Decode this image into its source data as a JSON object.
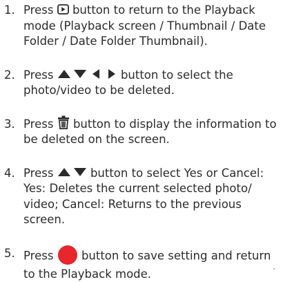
{
  "steps": [
    {
      "number": "1.",
      "before": "Press",
      "icon": "playback-icon",
      "after": "button to return to the Playback mode (Playback screen / Thumbnail / Date Folder / Date Folder Thumbnail)."
    },
    {
      "number": "2.",
      "before": "Press",
      "icon": "arrow-buttons-icon",
      "after": "button to select the photo/video to be deleted."
    },
    {
      "number": "3.",
      "before": "Press",
      "icon": "trash-icon",
      "after": "button to display the information to be deleted on the screen."
    },
    {
      "number": "4.",
      "before": "Press",
      "icon": "up-down-arrows-icon",
      "after": "button to select Yes or Cancel:",
      "extra": "Yes: Deletes the current selected photo/ video; Cancel: Returns to the previous screen."
    },
    {
      "number": "5.",
      "before": "Press",
      "icon": "record-button-icon",
      "after": "button to save setting and return to the Playback mode."
    }
  ],
  "colors": {
    "text": "#2b2b2b",
    "record_button": "#e8262b"
  }
}
